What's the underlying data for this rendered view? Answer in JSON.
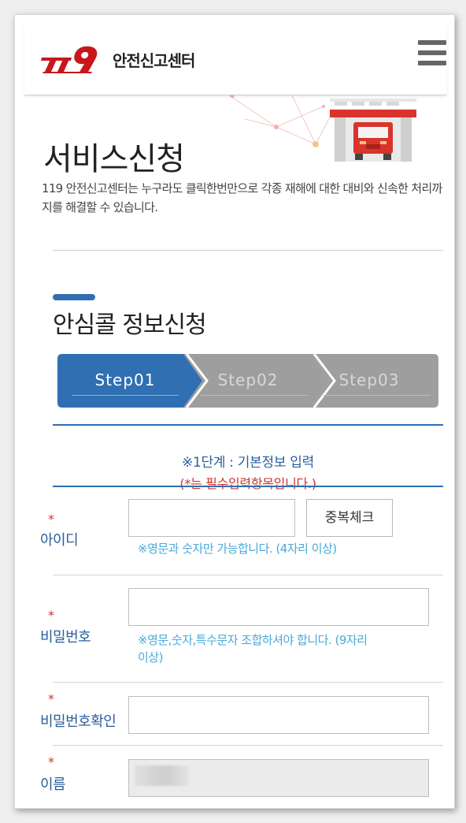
{
  "header": {
    "logo_text": "안전신고센터",
    "menu_icon": "hamburger-menu-icon"
  },
  "hero": {
    "title": "서비스신청",
    "description": "119 안전신고센터는 누구라도 클릭한번만으로 각종 재해에 대한 대비와 신속한 처리까지를 해결할 수 있습니다."
  },
  "section": {
    "title": "안심콜 정보신청"
  },
  "steps": [
    {
      "label": "Step01",
      "active": true
    },
    {
      "label": "Step02",
      "active": false
    },
    {
      "label": "Step03",
      "active": false
    }
  ],
  "info": {
    "title": "※1단계 : 기본정보 입력",
    "required_note": "(*는 필수입력항목입니다.)"
  },
  "form": {
    "required_mark": "*",
    "id": {
      "label": "아이디",
      "value": "",
      "check_button": "중복체크",
      "hint": "※영문과 숫자만 가능합니다. (4자리 이상)"
    },
    "password": {
      "label": "비밀번호",
      "value": "",
      "hint_line1": "※영문,숫자,특수문자 조합하셔야 합니다. (9자리",
      "hint_line2": "이상)"
    },
    "password_confirm": {
      "label": "비밀번호확인",
      "value": ""
    },
    "name": {
      "label": "이름",
      "value": ""
    }
  },
  "colors": {
    "accent": "#2f6fb2",
    "step_inactive": "#9e9e9e",
    "required": "#d0342c",
    "hint": "#4aa8d8",
    "logo_red": "#c8161d"
  }
}
